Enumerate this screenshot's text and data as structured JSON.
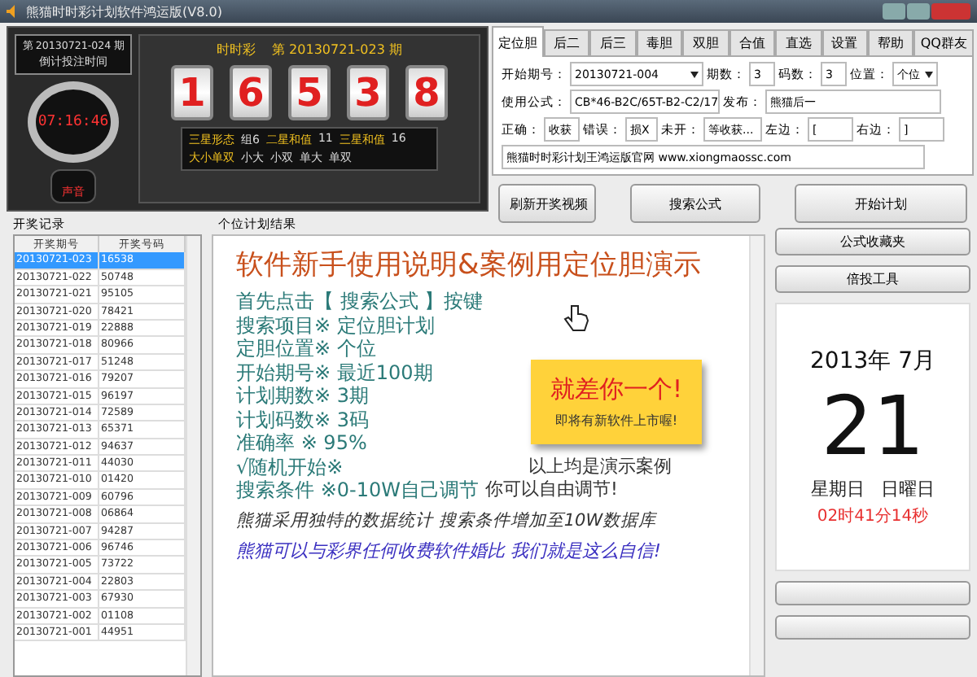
{
  "window": {
    "title": "熊猫时时彩计划软件鸿运版(V8.0)"
  },
  "countdown": {
    "next_issue": "第 20130721-024 期",
    "label": "倒计投注时间",
    "time": "07:16:46",
    "sound_label": "声音"
  },
  "draw": {
    "game": "时时彩",
    "issue": "第 20130721-023 期",
    "digits": [
      "1",
      "6",
      "5",
      "3",
      "8"
    ]
  },
  "stats": [
    {
      "label": "三星形态",
      "value": "组6"
    },
    {
      "label": "二星和值",
      "value": "11"
    },
    {
      "label": "三星和值",
      "value": "16"
    }
  ],
  "size_parity": {
    "label": "大小单双",
    "values": [
      "小大",
      "小双",
      "单大",
      "单双"
    ]
  },
  "tabs": [
    {
      "label": "定位胆",
      "selected": true
    },
    {
      "label": "后二",
      "selected": false
    },
    {
      "label": "后三",
      "selected": false
    },
    {
      "label": "毒胆",
      "selected": false
    },
    {
      "label": "双胆",
      "selected": false
    },
    {
      "label": "合值",
      "selected": false
    },
    {
      "label": "直选",
      "selected": false
    },
    {
      "label": "设置",
      "selected": false
    },
    {
      "label": "帮助",
      "selected": false
    },
    {
      "label": "QQ群友",
      "selected": false
    }
  ],
  "form": {
    "start_issue_label": "开始期号：",
    "start_issue": "20130721-004",
    "periods_label": "期数：",
    "periods": "3",
    "codes_label": "码数：",
    "codes": "3",
    "position_label": "位置：",
    "position": "个位",
    "formula_label": "使用公式：",
    "formula": "CB*46-B2C/65T-B2-C2/17",
    "publish_label": "发布：",
    "publish": "熊猫后一",
    "correct_label": "正确：",
    "correct": "收获",
    "wrong_label": "错误：",
    "wrong": "损X",
    "unopened_label": "未开：",
    "unopened": "等收获...",
    "left_label": "左边：",
    "left": "[",
    "right_label": "右边：",
    "right": "]",
    "note": "熊猫时时彩计划王鸿运版官网 www.xiongmaossc.com"
  },
  "actions": [
    "刷新开奖视频",
    "搜索公式",
    "开始计划"
  ],
  "history": {
    "title": "开奖记录",
    "columns": [
      "开奖期号",
      "开奖号码"
    ],
    "rows": [
      {
        "issue": "20130721-023",
        "number": "16538",
        "selected": true
      },
      {
        "issue": "20130721-022",
        "number": "50748",
        "selected": false
      },
      {
        "issue": "20130721-021",
        "number": "95105",
        "selected": false
      },
      {
        "issue": "20130721-020",
        "number": "78421",
        "selected": false
      },
      {
        "issue": "20130721-019",
        "number": "22888",
        "selected": false
      },
      {
        "issue": "20130721-018",
        "number": "80966",
        "selected": false
      },
      {
        "issue": "20130721-017",
        "number": "51248",
        "selected": false
      },
      {
        "issue": "20130721-016",
        "number": "79207",
        "selected": false
      },
      {
        "issue": "20130721-015",
        "number": "96197",
        "selected": false
      },
      {
        "issue": "20130721-014",
        "number": "72589",
        "selected": false
      },
      {
        "issue": "20130721-013",
        "number": "65371",
        "selected": false
      },
      {
        "issue": "20130721-012",
        "number": "94637",
        "selected": false
      },
      {
        "issue": "20130721-011",
        "number": "44030",
        "selected": false
      },
      {
        "issue": "20130721-010",
        "number": "01420",
        "selected": false
      },
      {
        "issue": "20130721-009",
        "number": "60796",
        "selected": false
      },
      {
        "issue": "20130721-008",
        "number": "06864",
        "selected": false
      },
      {
        "issue": "20130721-007",
        "number": "94287",
        "selected": false
      },
      {
        "issue": "20130721-006",
        "number": "96746",
        "selected": false
      },
      {
        "issue": "20130721-005",
        "number": "73722",
        "selected": false
      },
      {
        "issue": "20130721-004",
        "number": "22803",
        "selected": false
      },
      {
        "issue": "20130721-003",
        "number": "67930",
        "selected": false
      },
      {
        "issue": "20130721-002",
        "number": "01108",
        "selected": false
      },
      {
        "issue": "20130721-001",
        "number": "44951",
        "selected": false
      }
    ]
  },
  "result": {
    "title": "个位计划结果",
    "heading": "软件新手使用说明&案例用定位胆演示",
    "steps": [
      "首先点击【 搜索公式 】按键",
      "搜索项目※ 定位胆计划",
      "定胆位置※ 个位",
      "开始期号※ 最近100期",
      "计划期数※ 3期",
      "计划码数※ 3码",
      "准确率 ※ 95%",
      "√随机开始※",
      "搜索条件 ※0-10W自己调节"
    ],
    "note_title": "就差你一个!",
    "note_sub": "即将有新软件上市喔!",
    "demo_note": "以上均是演示案例",
    "free_note": "你可以自由调节!",
    "line1": "熊猫采用独特的数据统计 搜索条件增加至10W数据库",
    "line2": "熊猫可以与彩界任何收费软件婚比 我们就是这么自信!"
  },
  "side_buttons": [
    "公式收藏夹",
    "倍投工具"
  ],
  "calendar": {
    "year_month": "2013年  7月",
    "day": "21",
    "weekday": "星期日",
    "weekday_jp": "日曜日",
    "time": "02时41分14秒"
  }
}
